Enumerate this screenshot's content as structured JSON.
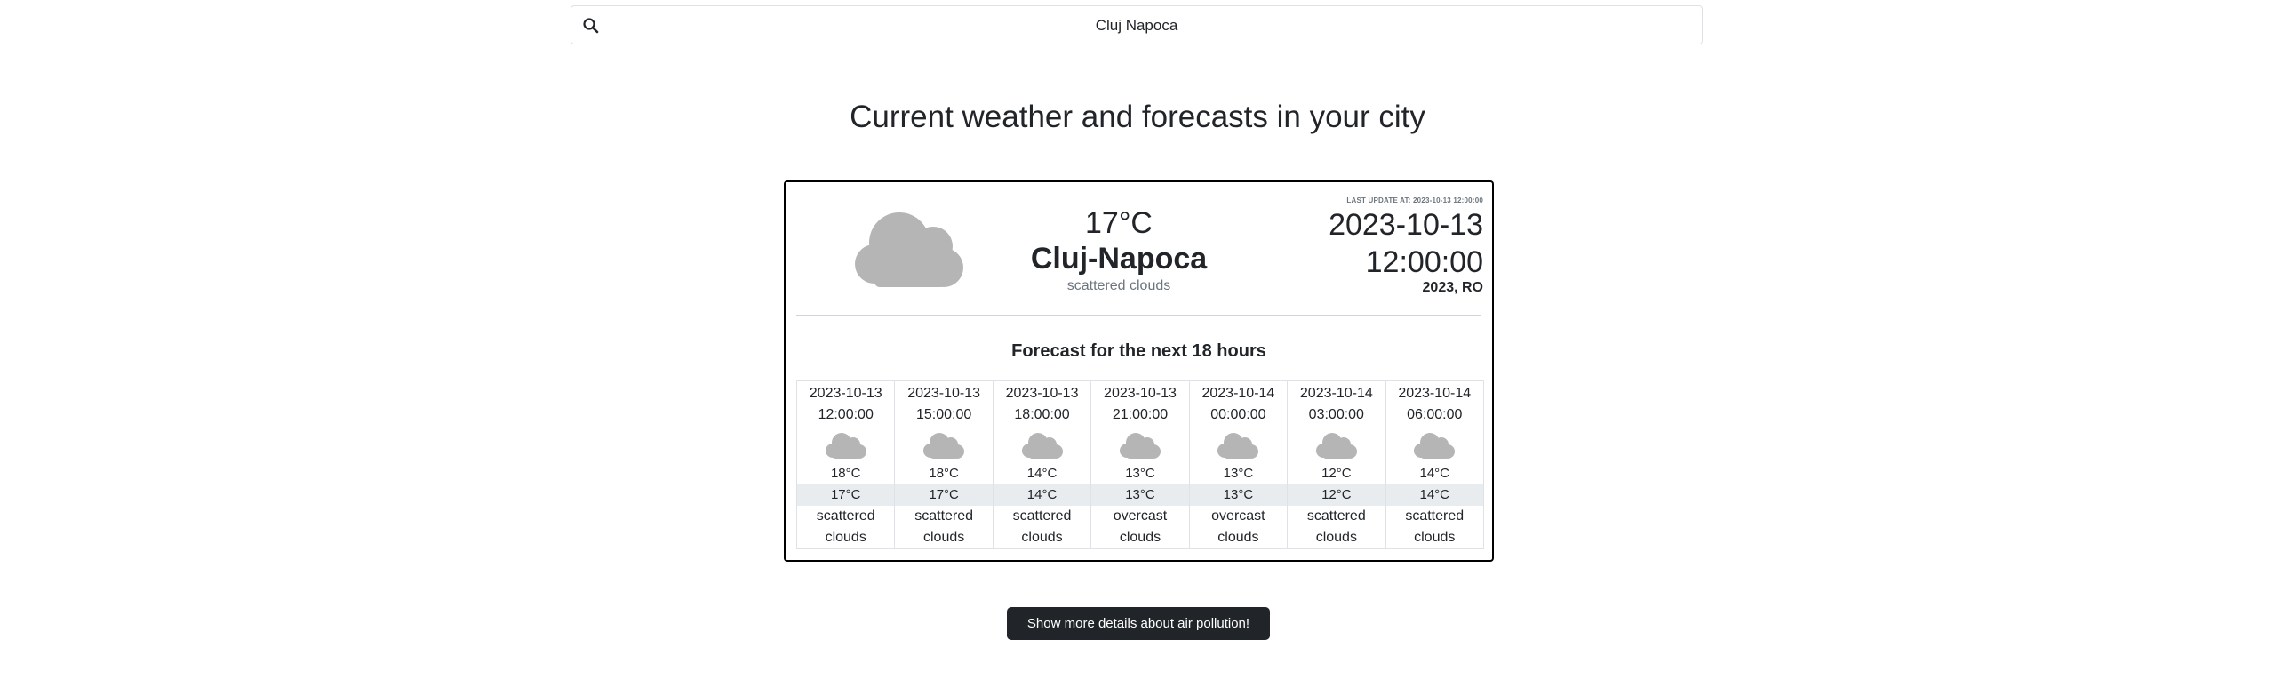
{
  "search": {
    "value": "Cluj Napoca",
    "placeholder": ""
  },
  "page_title": "Current weather and forecasts in your city",
  "current": {
    "icon": "cloud-icon",
    "temperature": "17°C",
    "city": "Cluj-Napoca",
    "description": "scattered clouds",
    "last_update": "LAST UPDATE AT: 2023-10-13 12:00:00",
    "date": "2023-10-13",
    "time": "12:00:00",
    "location": "2023, RO"
  },
  "forecast": {
    "title": "Forecast for the next 18 hours",
    "items": [
      {
        "date": "2023-10-13",
        "time": "12:00:00",
        "temp": "18°C",
        "feels": "17°C",
        "desc_1": "scattered",
        "desc_2": "clouds"
      },
      {
        "date": "2023-10-13",
        "time": "15:00:00",
        "temp": "18°C",
        "feels": "17°C",
        "desc_1": "scattered",
        "desc_2": "clouds"
      },
      {
        "date": "2023-10-13",
        "time": "18:00:00",
        "temp": "14°C",
        "feels": "14°C",
        "desc_1": "scattered",
        "desc_2": "clouds"
      },
      {
        "date": "2023-10-13",
        "time": "21:00:00",
        "temp": "13°C",
        "feels": "13°C",
        "desc_1": "overcast",
        "desc_2": "clouds"
      },
      {
        "date": "2023-10-14",
        "time": "00:00:00",
        "temp": "13°C",
        "feels": "13°C",
        "desc_1": "overcast",
        "desc_2": "clouds"
      },
      {
        "date": "2023-10-14",
        "time": "03:00:00",
        "temp": "12°C",
        "feels": "12°C",
        "desc_1": "scattered",
        "desc_2": "clouds"
      },
      {
        "date": "2023-10-14",
        "time": "06:00:00",
        "temp": "14°C",
        "feels": "14°C",
        "desc_1": "scattered",
        "desc_2": "clouds"
      }
    ]
  },
  "pollution_button": "Show more details about air pollution!",
  "colors": {
    "cloud": "#b5b5b5",
    "button_bg": "#212529"
  }
}
